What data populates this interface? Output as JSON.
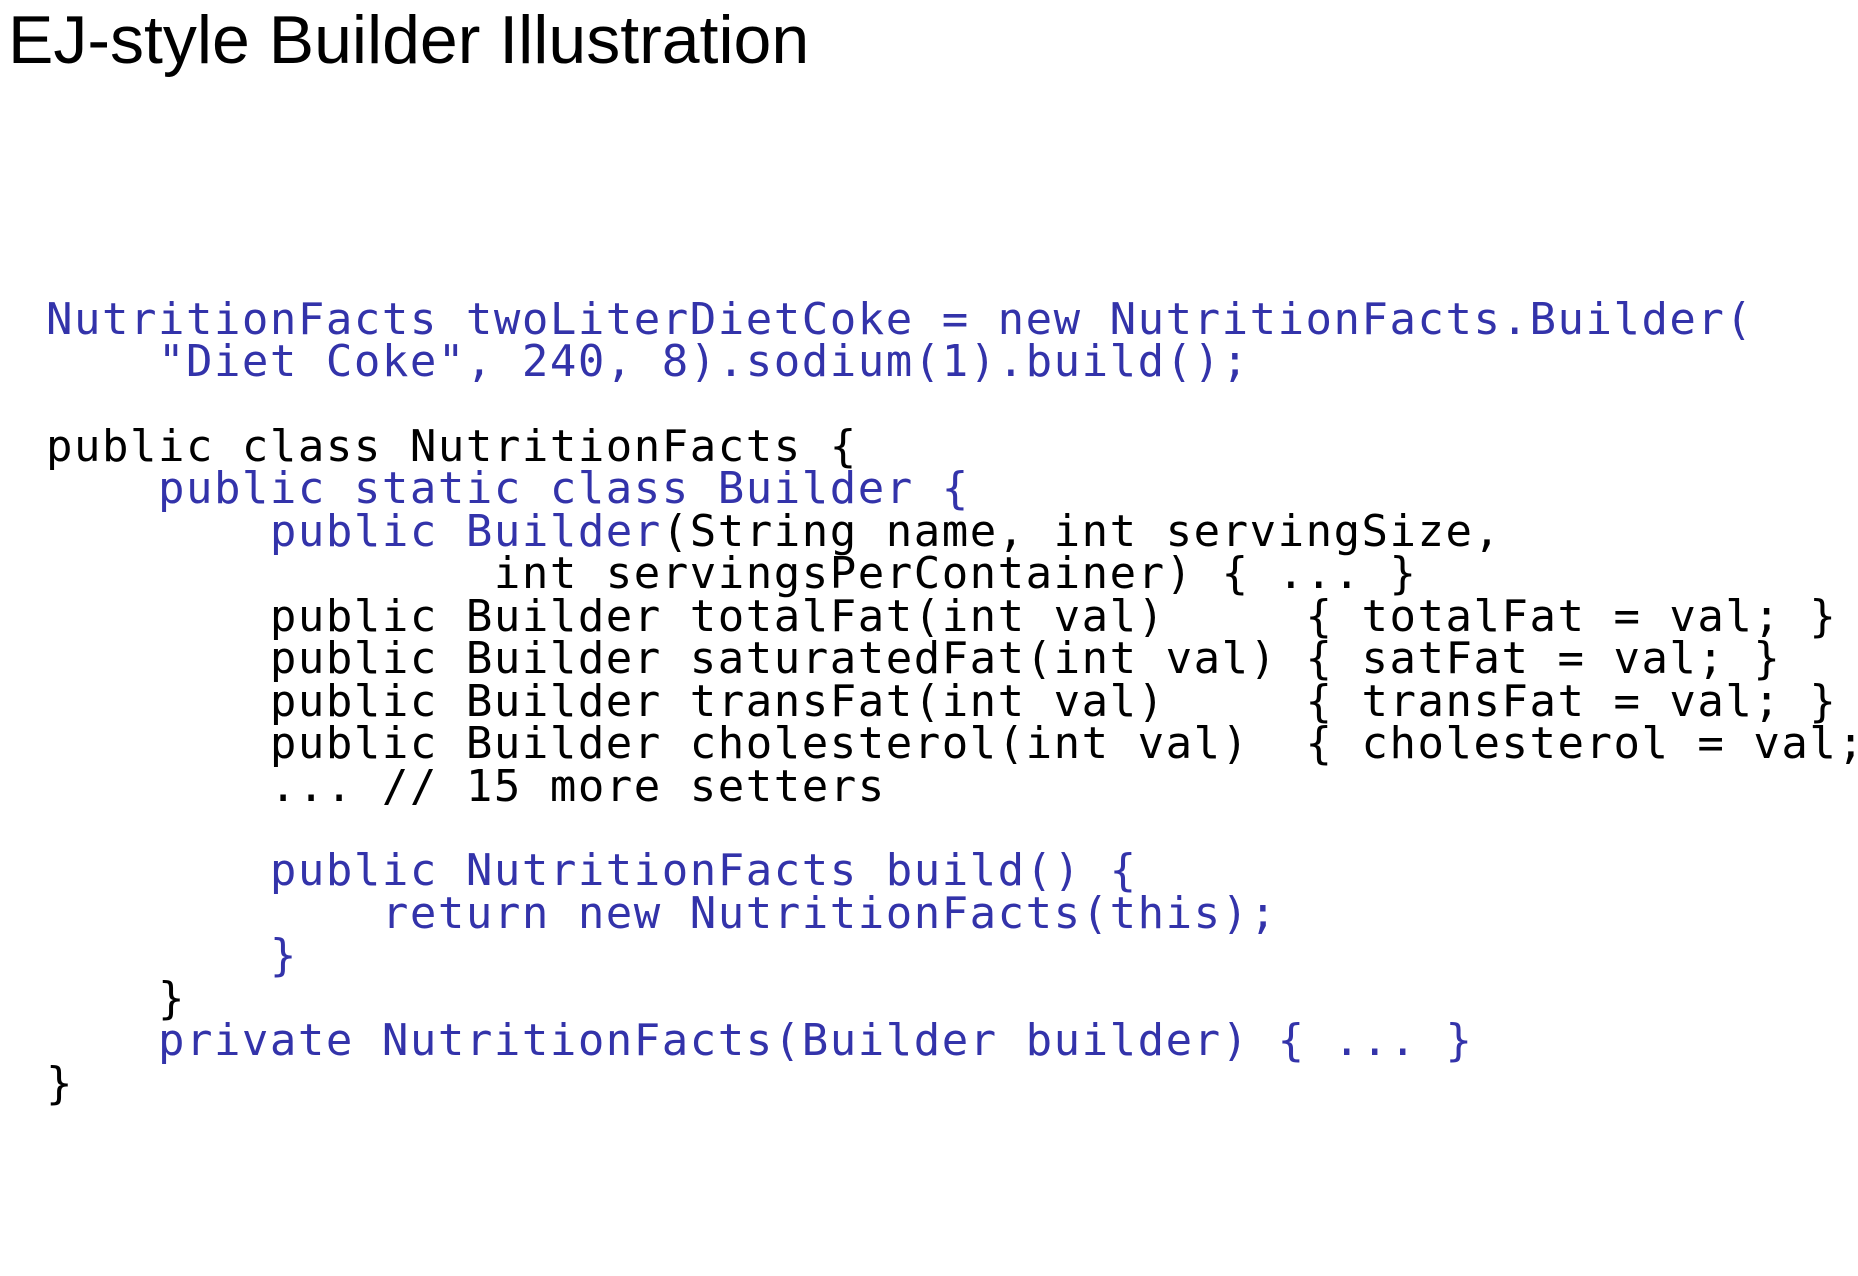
{
  "slide": {
    "title": "EJ-style Builder Illustration"
  },
  "code": {
    "lines": [
      {
        "tokens": [
          {
            "t": "NutritionFacts twoLiterDietCoke = new NutritionFacts.Builder(",
            "c": "hl"
          }
        ]
      },
      {
        "tokens": [
          {
            "t": "    \"Diet Coke\", 240, 8).sodium(1).build();",
            "c": "hl"
          }
        ]
      },
      {
        "tokens": [
          {
            "t": "public class NutritionFacts {",
            "c": "pl"
          }
        ]
      },
      {
        "tokens": [
          {
            "t": "    public static class Builder {",
            "c": "hl"
          }
        ]
      },
      {
        "tokens": [
          {
            "t": "        public Builder",
            "c": "hl"
          },
          {
            "t": "(String name, int servingSize,",
            "c": "pl"
          }
        ]
      },
      {
        "tokens": [
          {
            "t": "                int servingsPerContainer) { ... }",
            "c": "pl"
          }
        ]
      },
      {
        "tokens": [
          {
            "t": "        public Builder totalFat(int val)     { totalFat = val; }",
            "c": "pl"
          }
        ]
      },
      {
        "tokens": [
          {
            "t": "        public Builder saturatedFat(int val) { satFat = val; }",
            "c": "pl"
          }
        ]
      },
      {
        "tokens": [
          {
            "t": "        public Builder transFat(int val)     { transFat = val; }",
            "c": "pl"
          }
        ]
      },
      {
        "tokens": [
          {
            "t": "        public Builder cholesterol(int val)  { cholesterol = val; }",
            "c": "pl"
          }
        ]
      },
      {
        "tokens": [
          {
            "t": "        ... // 15 more setters",
            "c": "pl"
          }
        ]
      },
      {
        "tokens": [
          {
            "t": "        public NutritionFacts build() {",
            "c": "hl"
          }
        ]
      },
      {
        "tokens": [
          {
            "t": "            return new NutritionFacts(this);",
            "c": "hl"
          }
        ]
      },
      {
        "tokens": [
          {
            "t": "        }",
            "c": "hl"
          }
        ]
      },
      {
        "tokens": [
          {
            "t": "    }",
            "c": "pl"
          }
        ]
      },
      {
        "tokens": [
          {
            "t": "    private NutritionFacts(Builder builder) { ... }",
            "c": "hl"
          }
        ]
      },
      {
        "tokens": [
          {
            "t": "}",
            "c": "pl"
          }
        ]
      }
    ]
  },
  "colors": {
    "highlight": "#3333aa",
    "plain": "#000000",
    "background": "#ffffff"
  }
}
